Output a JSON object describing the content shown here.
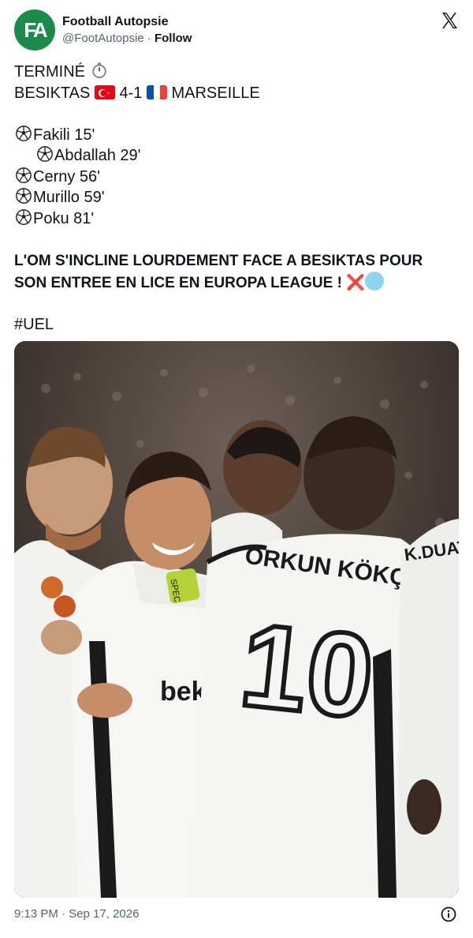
{
  "account": {
    "display_name": "Football Autopsie",
    "handle": "@FootAutopsie",
    "separator": " · ",
    "follow_label": "Follow",
    "avatar_letters": "FA",
    "avatar_color": "#1c8a4a"
  },
  "icons": {
    "platform": "x-logo-icon",
    "info": "info-icon",
    "timer": "stopwatch-icon",
    "ball": "soccer-ball-icon"
  },
  "tweet": {
    "status": "TERMINÉ",
    "score": {
      "home": "BESIKTAS",
      "result": "4-1",
      "away": "MARSEILLE"
    },
    "goals": [
      {
        "scorer": "Fakili 15'"
      },
      {
        "scorer": "Abdallah 29'"
      },
      {
        "scorer": "Cerny 56'"
      },
      {
        "scorer": "Murillo 59'"
      },
      {
        "scorer": "Poku 81'"
      }
    ],
    "headline": "L'OM S'INCLINE LOURDEMENT FACE A BESIKTAS POUR SON ENTREE EN LICE EN EUROPA LEAGUE !",
    "hashtag": "#UEL"
  },
  "photo": {
    "jersey_name": "ORKUN KÖKÇÜ",
    "jersey_number": "10",
    "sponsor": "beko",
    "armband": "SPEC",
    "other_name": "K.DUAT"
  },
  "footer": {
    "timestamp": "9:13 PM · Sep 17, 2026"
  }
}
